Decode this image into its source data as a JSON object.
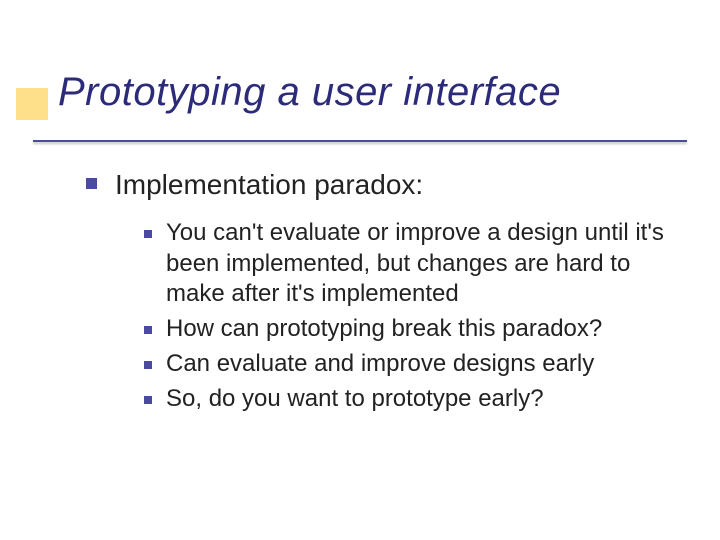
{
  "title": "Prototyping a user interface",
  "level1": "Implementation paradox:",
  "sub": [
    "You can't evaluate or improve a design until it's been implemented, but changes are hard to make after it's implemented",
    "How can prototyping break this paradox?",
    "Can evaluate and improve designs early",
    "So, do you want to prototype early?"
  ],
  "colors": {
    "accent": "#fee08a",
    "bullet": "#4a4a9f",
    "title": "#2b2b7a"
  }
}
